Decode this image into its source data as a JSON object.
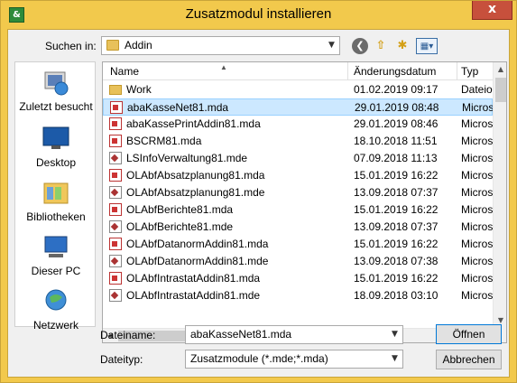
{
  "window": {
    "title": "Zusatzmodul installieren",
    "close_label": "x",
    "app_icon_glyph": "&"
  },
  "lookin": {
    "label": "Suchen in:",
    "value": "Addin"
  },
  "toolbar": {
    "back_icon": "back-arrow-icon",
    "up_icon": "up-folder-icon",
    "newfolder_icon": "new-folder-icon",
    "view_icon": "view-menu-icon"
  },
  "places": [
    {
      "label": "Zuletzt besucht",
      "icon": "recent-places-icon"
    },
    {
      "label": "Desktop",
      "icon": "desktop-icon"
    },
    {
      "label": "Bibliotheken",
      "icon": "libraries-icon"
    },
    {
      "label": "Dieser PC",
      "icon": "computer-icon"
    },
    {
      "label": "Netzwerk",
      "icon": "network-icon"
    }
  ],
  "columns": {
    "name": "Name",
    "date": "Änderungsdatum",
    "type": "Typ"
  },
  "files": [
    {
      "name": "Work",
      "date": "01.02.2019 09:17",
      "type": "Dateio",
      "kind": "folder"
    },
    {
      "name": "abaKasseNet81.mda",
      "date": "29.01.2019 08:48",
      "type": "Micros",
      "kind": "mda",
      "selected": true
    },
    {
      "name": "abaKassePrintAddin81.mda",
      "date": "29.01.2019 08:46",
      "type": "Micros",
      "kind": "mda"
    },
    {
      "name": "BSCRM81.mda",
      "date": "18.10.2018 11:51",
      "type": "Micros",
      "kind": "mda"
    },
    {
      "name": "LSInfoVerwaltung81.mde",
      "date": "07.09.2018 11:13",
      "type": "Micros",
      "kind": "mde"
    },
    {
      "name": "OLAbfAbsatzplanung81.mda",
      "date": "15.01.2019 16:22",
      "type": "Micros",
      "kind": "mda"
    },
    {
      "name": "OLAbfAbsatzplanung81.mde",
      "date": "13.09.2018 07:37",
      "type": "Micros",
      "kind": "mde"
    },
    {
      "name": "OLAbfBerichte81.mda",
      "date": "15.01.2019 16:22",
      "type": "Micros",
      "kind": "mda"
    },
    {
      "name": "OLAbfBerichte81.mde",
      "date": "13.09.2018 07:37",
      "type": "Micros",
      "kind": "mde"
    },
    {
      "name": "OLAbfDatanormAddin81.mda",
      "date": "15.01.2019 16:22",
      "type": "Micros",
      "kind": "mda"
    },
    {
      "name": "OLAbfDatanormAddin81.mde",
      "date": "13.09.2018 07:38",
      "type": "Micros",
      "kind": "mde"
    },
    {
      "name": "OLAbfIntrastatAddin81.mda",
      "date": "15.01.2019 16:22",
      "type": "Micros",
      "kind": "mda"
    },
    {
      "name": "OLAbfIntrastatAddin81.mde",
      "date": "18.09.2018 03:10",
      "type": "Micros",
      "kind": "mde"
    }
  ],
  "filename": {
    "label": "Dateiname:",
    "value": "abaKasseNet81.mda"
  },
  "filetype": {
    "label": "Dateityp:",
    "value": "Zusatzmodule (*.mde;*.mda)"
  },
  "buttons": {
    "open": "Öffnen",
    "cancel": "Abbrechen"
  }
}
